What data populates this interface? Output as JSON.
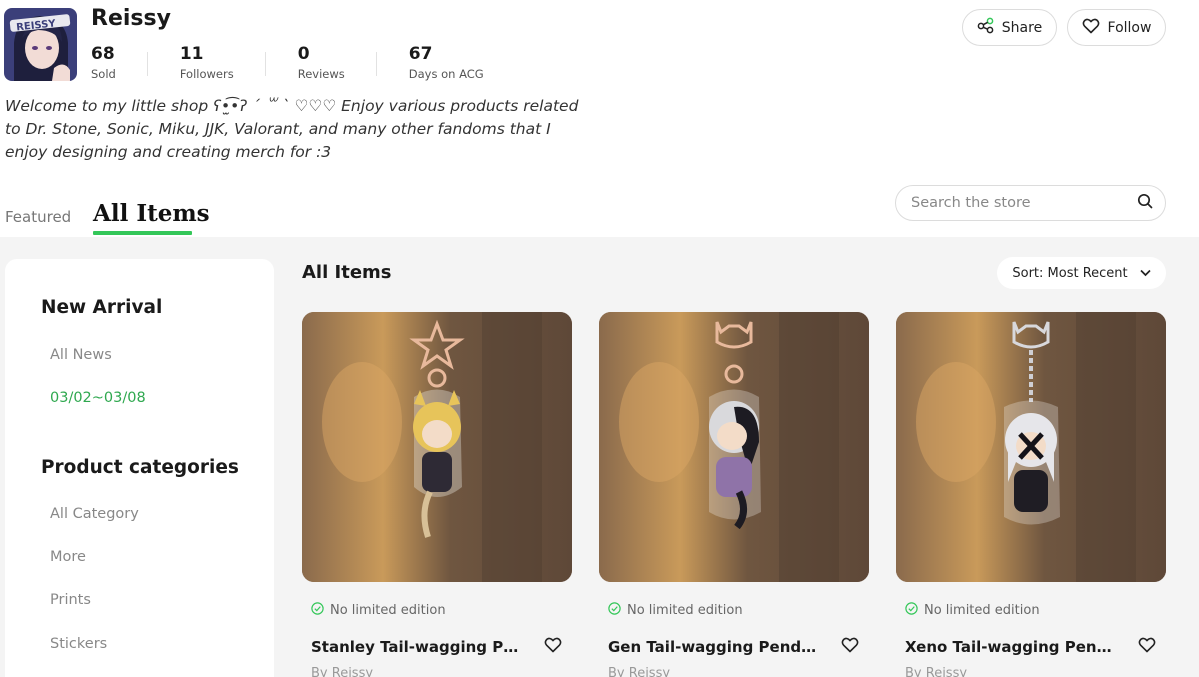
{
  "shop": {
    "name": "Reissy",
    "avatar_text": "REISSY",
    "stats": [
      {
        "value": "68",
        "label": "Sold"
      },
      {
        "value": "11",
        "label": "Followers"
      },
      {
        "value": "0",
        "label": "Reviews"
      },
      {
        "value": "67",
        "label": "Days on ACG"
      }
    ],
    "description": "Welcome to my little shop ʕ•̫͡•ʔ ´ ꒳ ` ♡♡♡ Enjoy various products related to Dr. Stone, Sonic, Miku, JJK, Valorant, and many other fandoms that I enjoy designing and creating merch for :3"
  },
  "actions": {
    "share_label": "Share",
    "follow_label": "Follow"
  },
  "tabs": {
    "featured": "Featured",
    "all_items": "All Items"
  },
  "search": {
    "placeholder": "Search the store"
  },
  "sidebar": {
    "new_arrival_heading": "New Arrival",
    "new_arrival_items": [
      "All News",
      "03/02~03/08"
    ],
    "categories_heading": "Product categories",
    "category_items": [
      "All Category",
      "More",
      "Prints",
      "Stickers"
    ]
  },
  "content": {
    "title": "All Items",
    "sort_label": "Sort: Most Recent"
  },
  "products": [
    {
      "badge": "No limited edition",
      "title": "Stanley Tail-wagging Pendant",
      "by": "By Reissy"
    },
    {
      "badge": "No limited edition",
      "title": "Gen Tail-wagging Pendant",
      "by": "By Reissy"
    },
    {
      "badge": "No limited edition",
      "title": "Xeno Tail-wagging Pendant",
      "by": "By Reissy"
    }
  ],
  "colors": {
    "accent": "#34c759",
    "active_link": "#2fa84f"
  }
}
